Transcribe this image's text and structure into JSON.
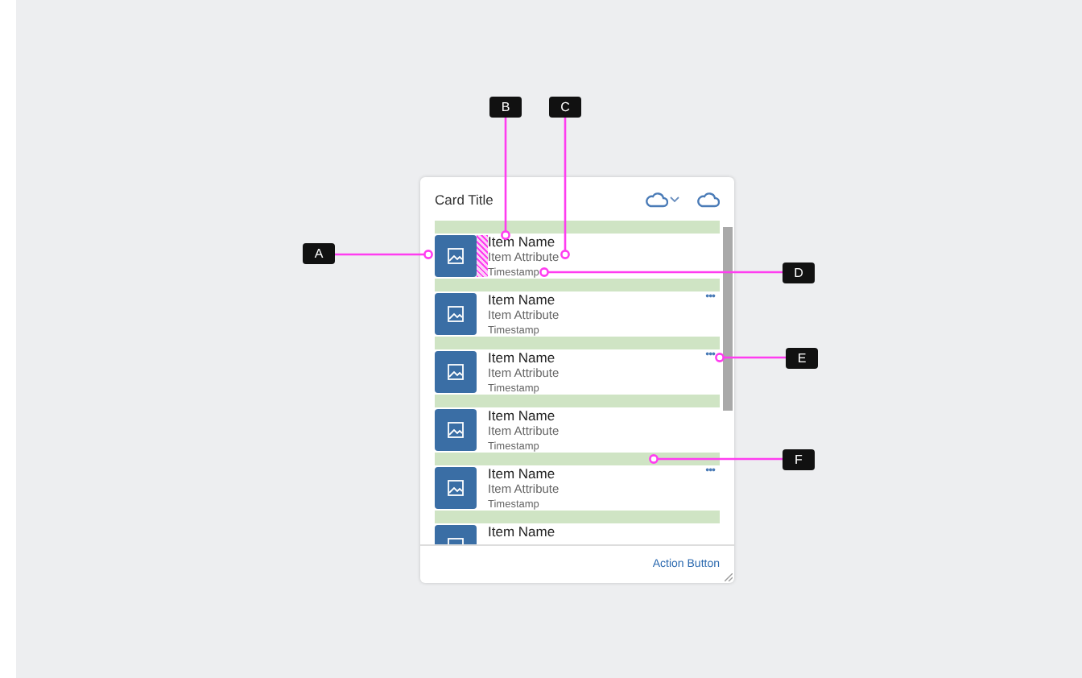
{
  "card": {
    "title": "Card Title",
    "items": [
      {
        "name": "Item Name",
        "attribute": "Item Attribute",
        "timestamp": "Timestamp",
        "spacing_marker": true
      },
      {
        "name": "Item Name",
        "attribute": "Item Attribute",
        "timestamp": "Timestamp",
        "more": "•••",
        "spacing_marker": false
      },
      {
        "name": "Item Name",
        "attribute": "Item Attribute",
        "timestamp": "Timestamp",
        "more": "•••",
        "spacing_marker": false
      },
      {
        "name": "Item Name",
        "attribute": "Item Attribute",
        "timestamp": "Timestamp",
        "spacing_marker": false
      },
      {
        "name": "Item Name",
        "attribute": "Item Attribute",
        "timestamp": "Timestamp",
        "more": "•••",
        "spacing_marker": false
      },
      {
        "name": "Item Name",
        "spacing_marker": false
      }
    ],
    "action": "Action Button"
  },
  "annotations": [
    {
      "label": "A"
    },
    {
      "label": "B"
    },
    {
      "label": "C"
    },
    {
      "label": "D"
    },
    {
      "label": "E"
    },
    {
      "label": "F"
    }
  ]
}
